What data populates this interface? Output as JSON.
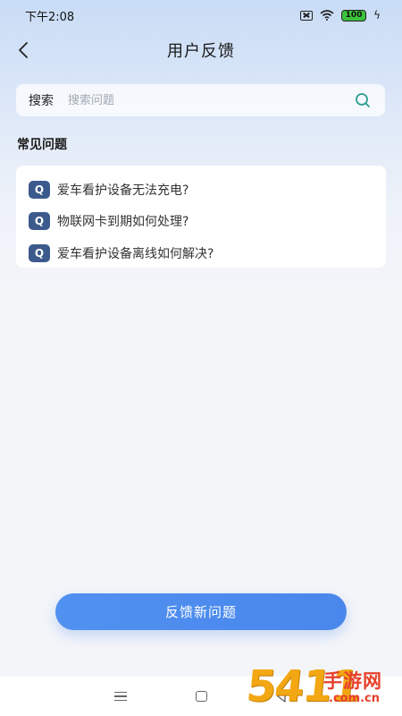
{
  "status_bar": {
    "time": "下午2:08",
    "battery": "100",
    "icons": [
      "sim-off-icon",
      "wifi-icon",
      "battery-icon",
      "charging-icon"
    ]
  },
  "header": {
    "title": "用户反馈",
    "back_icon": "chevron-left-icon"
  },
  "search": {
    "label": "搜索",
    "placeholder": "搜索问题",
    "value": "",
    "icon": "search-icon"
  },
  "faq": {
    "title": "常见问题",
    "badge": "Q",
    "items": [
      {
        "text": "爱车看护设备无法充电?"
      },
      {
        "text": "物联网卡到期如何处理?"
      },
      {
        "text": "爱车看护设备离线如何解决?"
      }
    ]
  },
  "feedback_button": {
    "label": "反馈新问题"
  },
  "nav_bar": {
    "icons": [
      "menu-icon",
      "home-icon",
      "back-icon"
    ]
  },
  "watermark": {
    "number": "5411",
    "text": "手游网",
    "domain": ".com.cn"
  },
  "colors": {
    "accent": "#4a87ec",
    "badge": "#3c5a8c",
    "gradient_top": "#c9dcf6",
    "background": "#f3f5f9",
    "watermark_orange": "#f3a712",
    "watermark_red": "#e7402b"
  }
}
